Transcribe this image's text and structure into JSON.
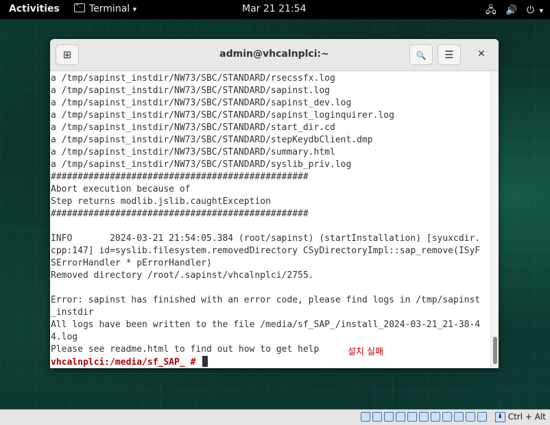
{
  "topbar": {
    "activities": "Activities",
    "app_name": "Terminal",
    "app_dropdown": "▾",
    "clock": "Mar 21  21:54",
    "network_icon": "network-icon",
    "volume_icon": "volume-icon",
    "power_icon": "power-icon",
    "network_glyph": "🖧",
    "volume_glyph": "🔊",
    "power_glyph": "⏻",
    "sys_dropdown": "▾"
  },
  "window": {
    "title": "admin@vhcalnplci:~",
    "new_tab_glyph": "⊞",
    "search_glyph": "🔍",
    "menu_glyph": "☰",
    "close_glyph": "✕"
  },
  "terminal": {
    "lines": [
      "a /tmp/sapinst_instdir/NW73/SBC/STANDARD/rsecssfx.log",
      "a /tmp/sapinst_instdir/NW73/SBC/STANDARD/sapinst.log",
      "a /tmp/sapinst_instdir/NW73/SBC/STANDARD/sapinst_dev.log",
      "a /tmp/sapinst_instdir/NW73/SBC/STANDARD/sapinst_loginquirer.log",
      "a /tmp/sapinst_instdir/NW73/SBC/STANDARD/start_dir.cd",
      "a /tmp/sapinst_instdir/NW73/SBC/STANDARD/stepKeydbClient.dmp",
      "a /tmp/sapinst_instdir/NW73/SBC/STANDARD/summary.html",
      "a /tmp/sapinst_instdir/NW73/SBC/STANDARD/syslib_priv.log",
      "################################################",
      "Abort execution because of",
      "Step returns modlib.jslib.caughtException",
      "################################################",
      "",
      "INFO       2024-03-21 21:54:05.384 (root/sapinst) (startInstallation) [syuxcdir.",
      "cpp:147] id=syslib.filesystem.removedDirectory CSyDirectoryImpl::sap_remove(ISyF",
      "SErrorHandler * pErrorHandler)",
      "Removed directory /root/.sapinst/vhcalnplci/2755.",
      "",
      "Error: sapinst has finished with an error code, please find logs in /tmp/sapinst",
      "_instdir",
      "All logs have been written to the file /media/sf_SAP_/install_2024-03-21_21-38-4",
      "4.log",
      "Please see readme.html to find out how to get help"
    ],
    "prompt": "vhcalnplci:/media/sf_SAP_ # ",
    "annotation": "설치 실패"
  },
  "statusbar": {
    "host_key": "Ctrl + Alt",
    "icons": [
      "hard-disk-icon",
      "optical-drive-icon",
      "audio-icon",
      "network-adapter-icon",
      "usb-icon",
      "shared-folders-icon",
      "display-icon",
      "recording-icon",
      "cpu-icon",
      "guest-additions-icon",
      "mouse-integration-icon"
    ]
  }
}
